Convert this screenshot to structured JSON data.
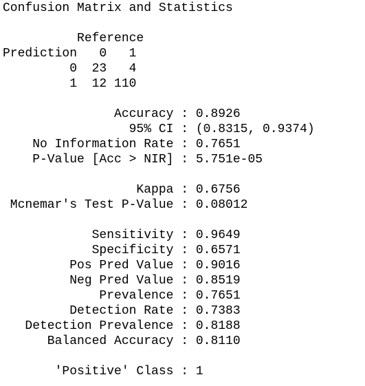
{
  "console": {
    "lines": [
      "Confusion Matrix and Statistics",
      "",
      "          Reference",
      "Prediction   0   1",
      "         0  23   4",
      "         1  12 110",
      "",
      "               Accuracy : 0.8926",
      "                 95% CI : (0.8315, 0.9374)",
      "    No Information Rate : 0.7651",
      "    P-Value [Acc > NIR] : 5.751e-05",
      "",
      "                  Kappa : 0.6756",
      " Mcnemar's Test P-Value : 0.08012",
      "",
      "            Sensitivity : 0.9649",
      "            Specificity : 0.6571",
      "         Pos Pred Value : 0.9016",
      "         Neg Pred Value : 0.8519",
      "             Prevalence : 0.7651",
      "         Detection Rate : 0.7383",
      "   Detection Prevalence : 0.8188",
      "      Balanced Accuracy : 0.8110",
      "",
      "       'Positive' Class : 1"
    ]
  }
}
